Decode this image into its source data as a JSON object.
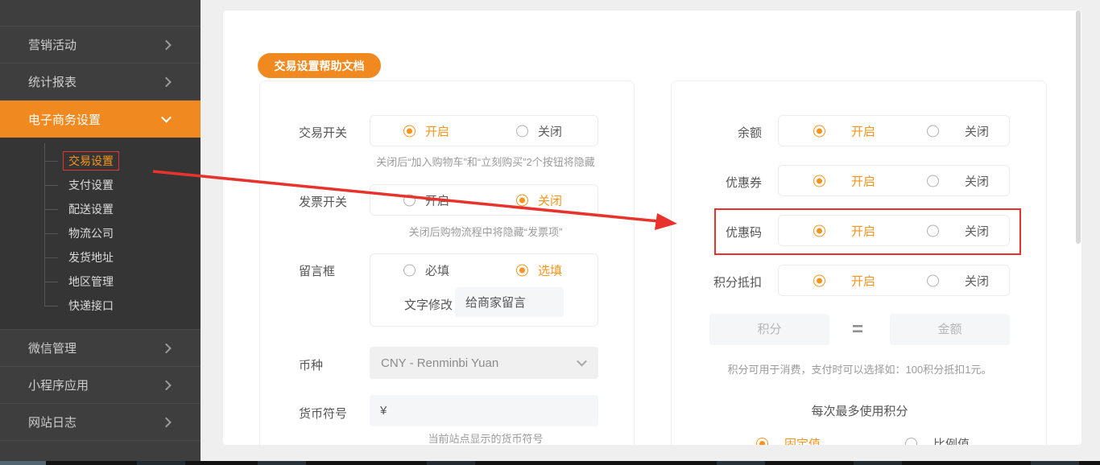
{
  "colors": {
    "accent_orange": "#f0891f",
    "radio_orange": "#f7941d",
    "annotation_red": "#e7332b"
  },
  "sidebar": {
    "items": [
      {
        "label": "营销活动"
      },
      {
        "label": "统计报表"
      },
      {
        "label": "电子商务设置",
        "state": "active-expanded"
      },
      {
        "label": "微信管理"
      },
      {
        "label": "小程序应用"
      },
      {
        "label": "网站日志"
      }
    ],
    "submenu": [
      {
        "label": "交易设置",
        "state": "current-highlighted"
      },
      {
        "label": "支付设置"
      },
      {
        "label": "配送设置"
      },
      {
        "label": "物流公司"
      },
      {
        "label": "发货地址"
      },
      {
        "label": "地区管理"
      },
      {
        "label": "快递接口"
      }
    ]
  },
  "toolbar": {
    "help_button": "交易设置帮助文档"
  },
  "left_panel": {
    "trade_switch": {
      "label": "交易开关",
      "on": "开启",
      "off": "关闭",
      "selected": "on",
      "hint": "关闭后“加入购物车”和“立刻购买”2个按钮将隐藏"
    },
    "invoice_switch": {
      "label": "发票开关",
      "on": "开启",
      "off": "关闭",
      "selected": "off",
      "hint": "关闭后购物流程中将隐藏“发票项”"
    },
    "message_box": {
      "label": "留言框",
      "required": "必填",
      "optional": "选填",
      "selected": "optional",
      "text_edit_label": "文字修改",
      "text_edit_value": "给商家留言"
    },
    "currency": {
      "label": "币种",
      "value": "CNY - Renminbi Yuan"
    },
    "currency_symbol": {
      "label": "货币符号",
      "value": "¥",
      "hint": "当前站点显示的货币符号"
    }
  },
  "right_panel": {
    "balance": {
      "label": "余额",
      "on": "开启",
      "off": "关闭",
      "selected": "on"
    },
    "coupon": {
      "label": "优惠券",
      "on": "开启",
      "off": "关闭",
      "selected": "on"
    },
    "coupon_code": {
      "label": "优惠码",
      "on": "开启",
      "off": "关闭",
      "selected": "on",
      "highlighted": true
    },
    "points_deduction": {
      "label": "积分抵扣",
      "on": "开启",
      "off": "关闭",
      "selected": "on"
    },
    "points_rate": {
      "points_placeholder": "积分",
      "equals": "=",
      "amount_placeholder": "金额",
      "hint": "积分可用于消费，支付时可以选择如：100积分抵扣1元。"
    },
    "max_points": {
      "title": "每次最多使用积分",
      "fixed": "固定值",
      "ratio": "比例值",
      "selected": "fixed"
    }
  }
}
